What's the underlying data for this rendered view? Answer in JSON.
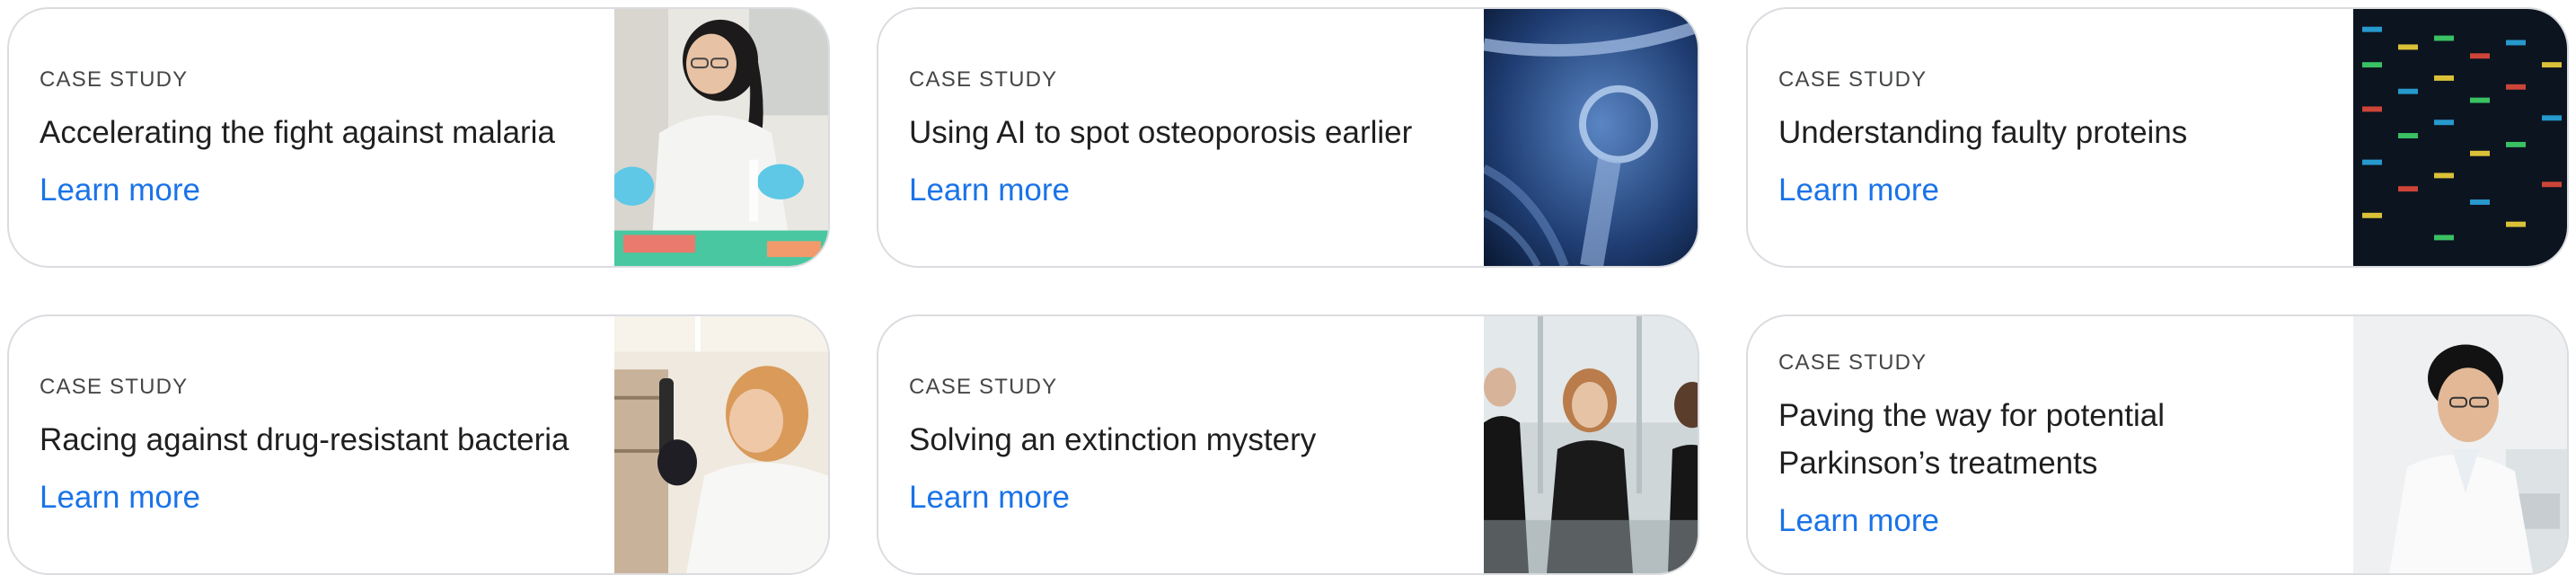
{
  "cards": [
    {
      "eyebrow": "CASE STUDY",
      "title": "Accelerating the fight against malaria",
      "link": "Learn more",
      "image": "scientist-lab-image"
    },
    {
      "eyebrow": "CASE STUDY",
      "title": "Using AI to spot osteoporosis earlier",
      "link": "Learn more",
      "image": "xray-shoulder-image"
    },
    {
      "eyebrow": "CASE STUDY",
      "title": "Understanding faulty proteins",
      "link": "Learn more",
      "image": "dna-gel-image"
    },
    {
      "eyebrow": "CASE STUDY",
      "title": "Racing against drug-resistant bacteria",
      "link": "Learn more",
      "image": "researcher-tube-image"
    },
    {
      "eyebrow": "CASE STUDY",
      "title": "Solving an extinction mystery",
      "link": "Learn more",
      "image": "team-people-image"
    },
    {
      "eyebrow": "CASE STUDY",
      "title": "Paving the way for potential Parkinson’s treatments",
      "link": "Learn more",
      "image": "scientist-microscope-image"
    }
  ],
  "colors": {
    "link": "#1a73e8",
    "border": "#dadce0",
    "text": "#1f1f1f",
    "eyebrow": "#444746"
  }
}
